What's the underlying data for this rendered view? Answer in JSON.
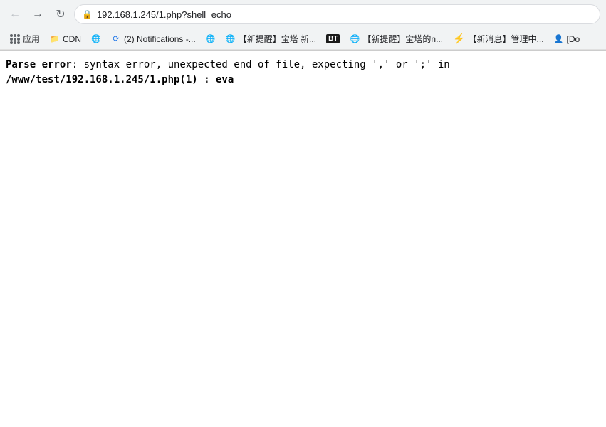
{
  "browser": {
    "url": "192.168.1.245/1.php?shell=echo",
    "back_btn": "←",
    "forward_btn": "→",
    "reload_btn": "↻"
  },
  "bookmarks": [
    {
      "id": "apps",
      "label": "应用",
      "type": "apps"
    },
    {
      "id": "cdn",
      "label": "CDN",
      "type": "folder-yellow"
    },
    {
      "id": "globe1",
      "label": "",
      "type": "globe-blue"
    },
    {
      "id": "notifications",
      "label": "(2) Notifications -...",
      "type": "spinner"
    },
    {
      "id": "globe2",
      "label": "",
      "type": "globe-green"
    },
    {
      "id": "baota1",
      "label": "【新提醒】宝塔 新...",
      "type": "globe-green"
    },
    {
      "id": "bt",
      "label": "BT",
      "type": "bt-black"
    },
    {
      "id": "baota2",
      "label": "【新提醒】宝塔的n...",
      "type": "globe-green"
    },
    {
      "id": "lightning",
      "label": "【新消息】管理中...",
      "type": "lightning-orange"
    },
    {
      "id": "user",
      "label": "[Do",
      "type": "user"
    }
  ],
  "page": {
    "error_label": "Parse error",
    "error_text": ": syntax error, unexpected end of file, expecting ',' or ';' in ",
    "error_path": "/www/test/192.168.1.245/1.php(1) : eva"
  }
}
